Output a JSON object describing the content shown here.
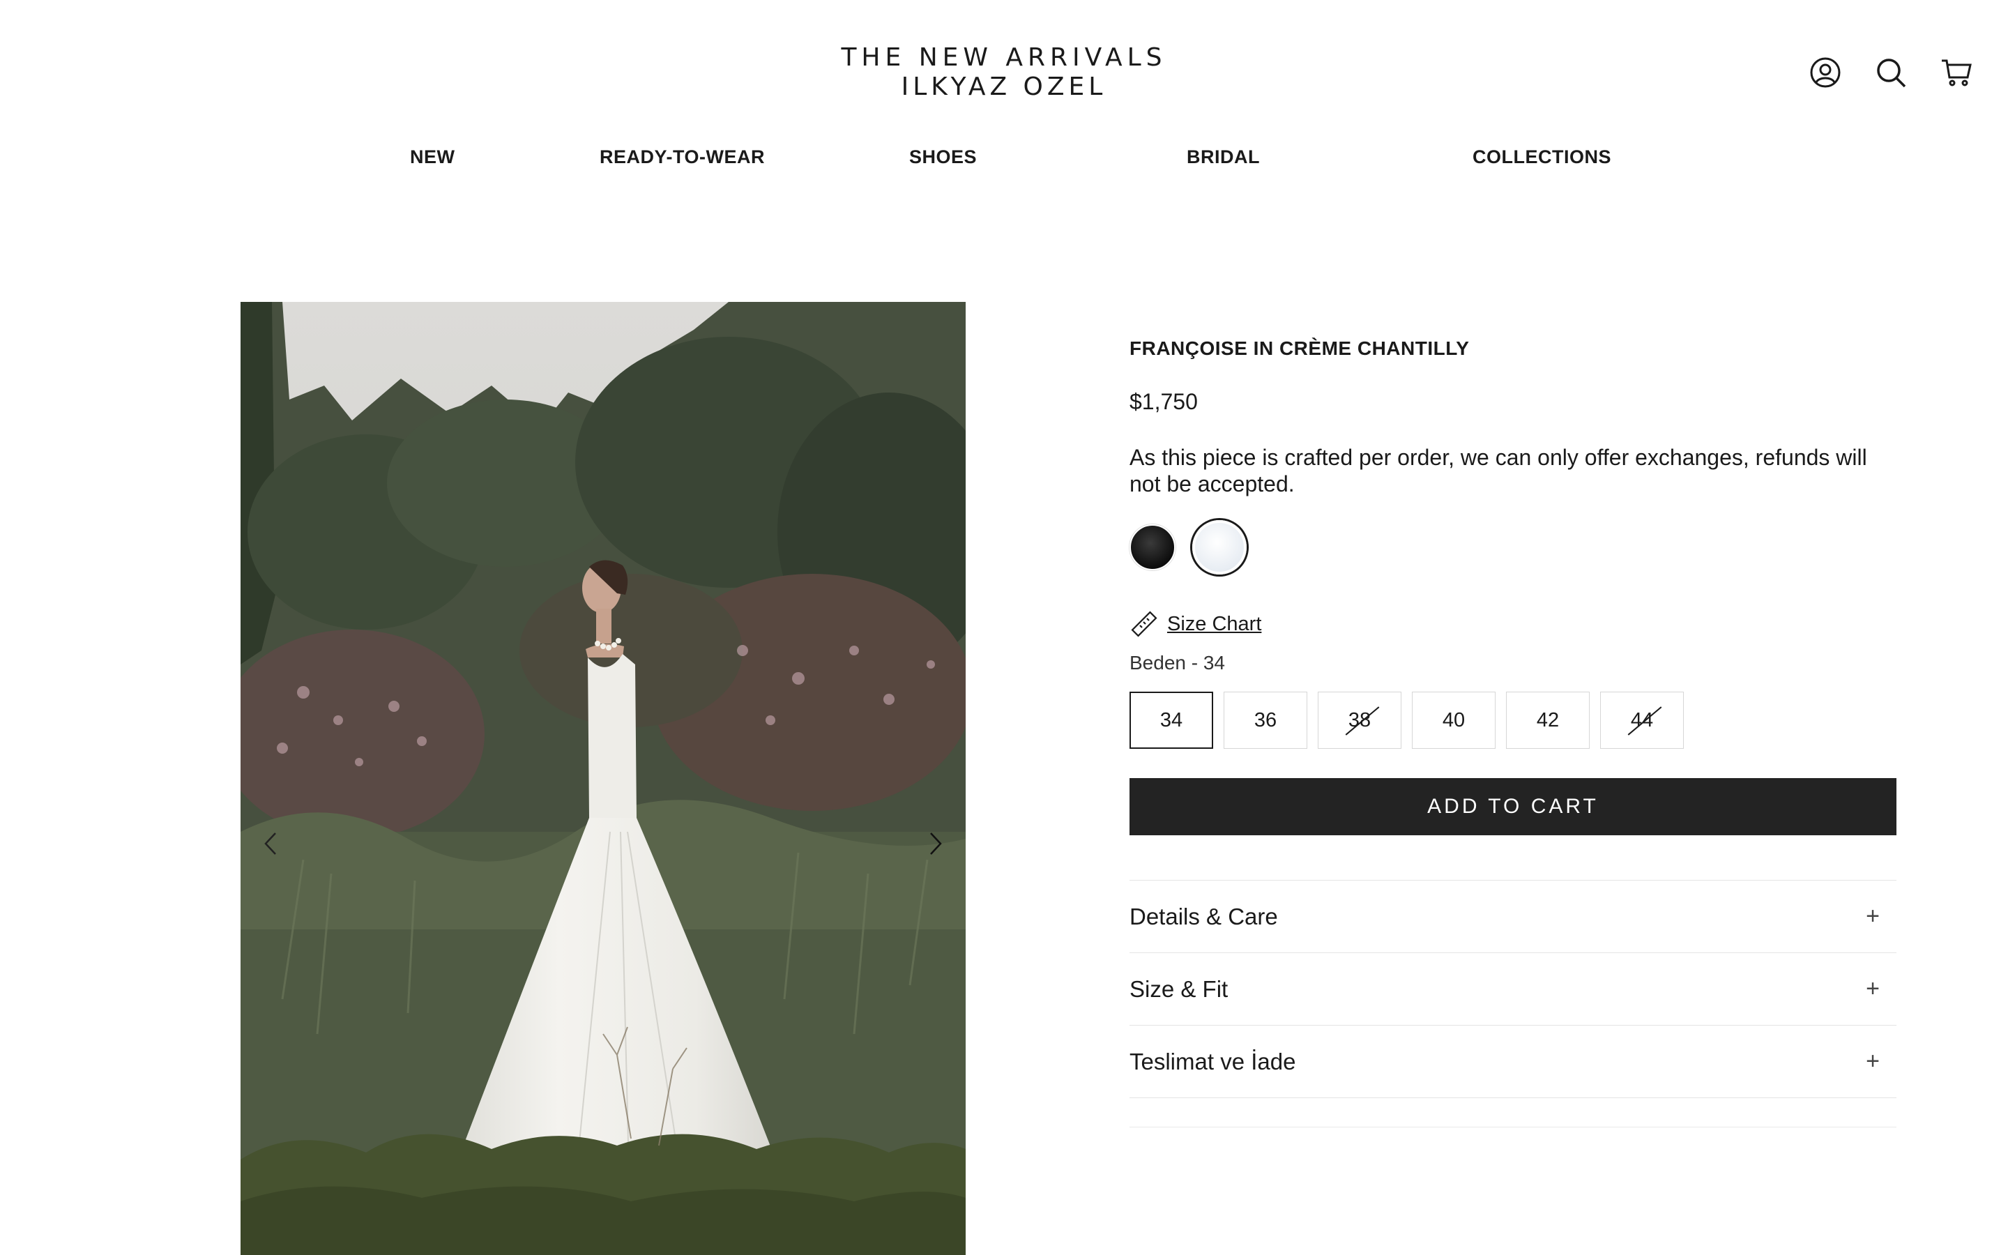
{
  "brand": {
    "line1": "THE NEW ARRIVALS",
    "line2": "ILKYAZ OZEL"
  },
  "header_icons": [
    "account-icon",
    "search-icon",
    "cart-icon"
  ],
  "nav": {
    "items": [
      "NEW",
      "READY-TO-WEAR",
      "SHOES",
      "BRIDAL",
      "COLLECTIONS"
    ]
  },
  "product": {
    "title": "FRANÇOISE IN CRÈME CHANTILLY",
    "price": "$1,750",
    "note": "As this piece is crafted per order, we can only offer exchanges, refunds will not be accepted.",
    "swatches": [
      {
        "name": "Black",
        "color": "#111111",
        "selected": false
      },
      {
        "name": "Crème Chantilly",
        "color": "#f2f4f7",
        "selected": true
      }
    ],
    "size_chart_label": "Size Chart",
    "size_label": "Beden - 34",
    "sizes": [
      {
        "label": "34",
        "selected": true,
        "available": true
      },
      {
        "label": "36",
        "selected": false,
        "available": true
      },
      {
        "label": "38",
        "selected": false,
        "available": false
      },
      {
        "label": "40",
        "selected": false,
        "available": true
      },
      {
        "label": "42",
        "selected": false,
        "available": true
      },
      {
        "label": "44",
        "selected": false,
        "available": false
      }
    ],
    "add_to_cart": "ADD TO CART",
    "accordion": [
      "Details & Care",
      "Size & Fit",
      "Teslimat ve İade"
    ]
  },
  "colors": {
    "button_bg": "#232323",
    "text": "#1a1a1a"
  }
}
